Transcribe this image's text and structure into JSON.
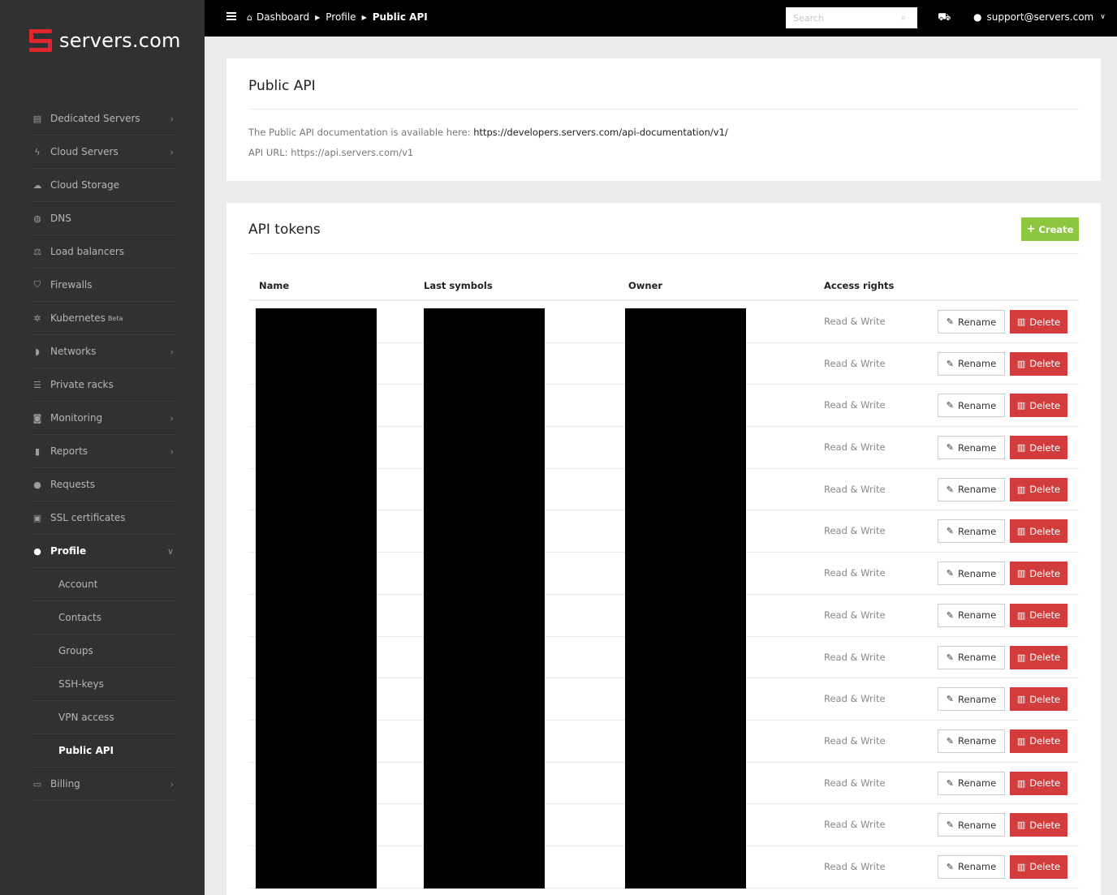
{
  "brand": {
    "name": "servers.com"
  },
  "sidebar": {
    "items": [
      {
        "label": "Dedicated Servers",
        "icon": "server-icon",
        "glyph": "▤",
        "chevron": true
      },
      {
        "label": "Cloud Servers",
        "icon": "bolt-icon",
        "glyph": "ϟ",
        "chevron": true
      },
      {
        "label": "Cloud Storage",
        "icon": "cloud-icon",
        "glyph": "☁",
        "chevron": false
      },
      {
        "label": "DNS",
        "icon": "globe-icon",
        "glyph": "◍",
        "chevron": false
      },
      {
        "label": "Load balancers",
        "icon": "balance-icon",
        "glyph": "⚖",
        "chevron": false
      },
      {
        "label": "Firewalls",
        "icon": "shield-icon",
        "glyph": "⛉",
        "chevron": false
      },
      {
        "label": "Kubernetes",
        "badge": "Beta",
        "icon": "kubernetes-icon",
        "glyph": "✲",
        "chevron": false
      },
      {
        "label": "Networks",
        "icon": "signal-icon",
        "glyph": "◗",
        "chevron": true
      },
      {
        "label": "Private racks",
        "icon": "rack-icon",
        "glyph": "☰",
        "chevron": false
      },
      {
        "label": "Monitoring",
        "icon": "camera-icon",
        "glyph": "◙",
        "chevron": true
      },
      {
        "label": "Reports",
        "icon": "file-icon",
        "glyph": "▮",
        "chevron": true
      },
      {
        "label": "Requests",
        "icon": "chat-icon",
        "glyph": "●",
        "chevron": false
      },
      {
        "label": "SSL certificates",
        "icon": "lock-icon",
        "glyph": "▣",
        "chevron": false
      },
      {
        "label": "Profile",
        "icon": "user-icon",
        "glyph": "●",
        "chevron": true,
        "active": true
      }
    ],
    "profile_sub": [
      {
        "label": "Account"
      },
      {
        "label": "Contacts"
      },
      {
        "label": "Groups"
      },
      {
        "label": "SSH-keys"
      },
      {
        "label": "VPN access"
      },
      {
        "label": "Public API",
        "current": true
      }
    ],
    "billing": {
      "label": "Billing",
      "icon": "money-icon",
      "glyph": "▭"
    }
  },
  "topbar": {
    "breadcrumb": [
      "Dashboard",
      "Profile",
      "Public API"
    ],
    "search_placeholder": "Search",
    "user_email": "support@servers.com"
  },
  "public_api": {
    "title": "Public API",
    "doc_prefix": "The Public API documentation is available here: ",
    "doc_link": "https://developers.servers.com/api-documentation/v1/",
    "api_url_line": "API URL: https://api.servers.com/v1"
  },
  "tokens": {
    "title": "API tokens",
    "create_label": "Create",
    "columns": [
      "Name",
      "Last symbols",
      "Owner",
      "Access rights"
    ],
    "rows": [
      {
        "access": "Read & Write"
      },
      {
        "access": "Read & Write"
      },
      {
        "access": "Read & Write"
      },
      {
        "access": "Read & Write"
      },
      {
        "access": "Read & Write"
      },
      {
        "access": "Read & Write"
      },
      {
        "access": "Read & Write"
      },
      {
        "access": "Read & Write"
      },
      {
        "access": "Read & Write"
      },
      {
        "access": "Read & Write"
      },
      {
        "access": "Read & Write"
      },
      {
        "access": "Read & Write"
      },
      {
        "access": "Read & Write"
      },
      {
        "access": "Read & Write"
      }
    ],
    "rename_label": "Rename",
    "delete_label": "Delete"
  },
  "colors": {
    "brand_red": "#e0252c",
    "create_green": "#8dc63f",
    "delete_red": "#d23c3c",
    "sidebar_bg": "#2f3133"
  }
}
